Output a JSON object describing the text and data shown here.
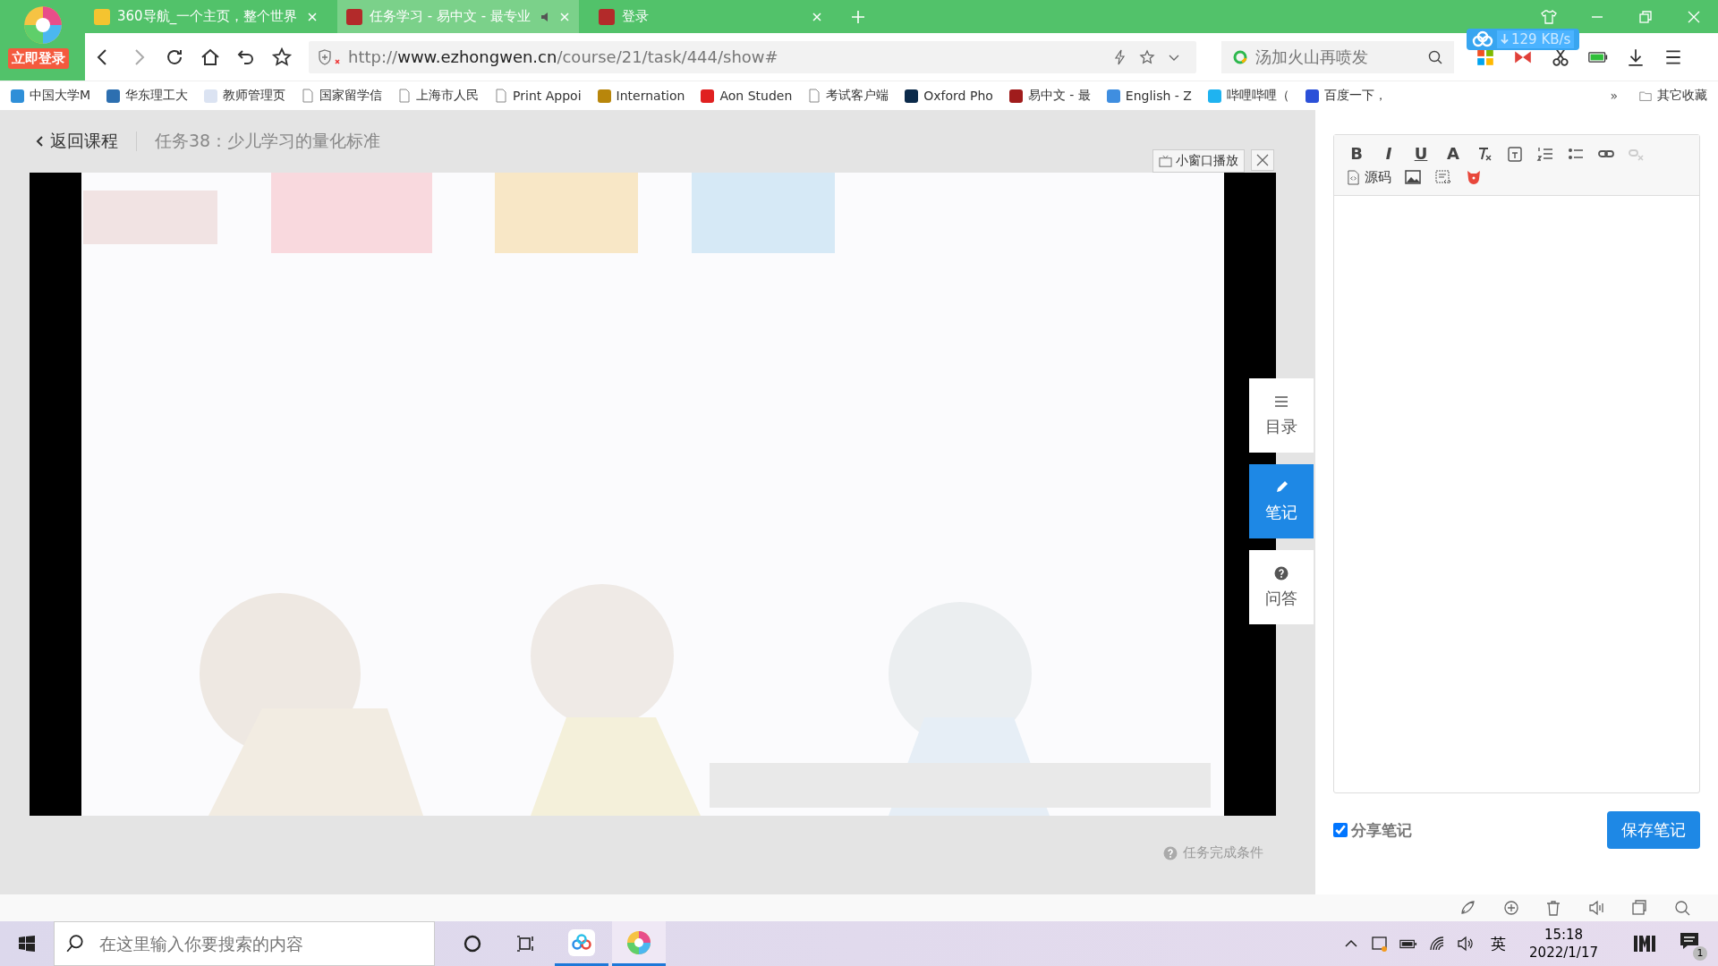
{
  "browser": {
    "login_badge": "立即登录",
    "tabs": [
      {
        "title": "360导航_一个主页，整个世界",
        "selected": false,
        "audio": false
      },
      {
        "title": "任务学习 - 易中文 - 最专业",
        "selected": true,
        "audio": true
      },
      {
        "title": "登录",
        "selected": false,
        "audio": false
      }
    ],
    "address": {
      "host": "www.ezhongwen.cn",
      "scheme": "http://",
      "path": "/course/21/task/444/show#"
    },
    "search": {
      "placeholder": "汤加火山再喷发"
    },
    "download_speed": "129 KB/s",
    "bookmarks": [
      {
        "label": "中国大学M",
        "kind": "site"
      },
      {
        "label": "华东理工大",
        "kind": "site"
      },
      {
        "label": "教师管理页",
        "kind": "site"
      },
      {
        "label": "国家留学信",
        "kind": "page"
      },
      {
        "label": "上海市人民",
        "kind": "page"
      },
      {
        "label": "Print Appoi",
        "kind": "page"
      },
      {
        "label": "Internation",
        "kind": "site"
      },
      {
        "label": "Aon Studen",
        "kind": "site"
      },
      {
        "label": "考试客户端",
        "kind": "page"
      },
      {
        "label": "Oxford Pho",
        "kind": "site"
      },
      {
        "label": "易中文 - 最",
        "kind": "site"
      },
      {
        "label": "English - Z",
        "kind": "site"
      },
      {
        "label": "哔哩哔哩（",
        "kind": "site"
      },
      {
        "label": "百度一下，",
        "kind": "site"
      }
    ],
    "more": "»",
    "other_bookmarks": "其它收藏"
  },
  "page": {
    "back_link": "返回课程",
    "task_title": "任务38：少儿学习的量化标准",
    "mini_player": "小窗口播放",
    "side_tabs": [
      {
        "label": "目录",
        "kind": "list",
        "selected": false
      },
      {
        "label": "笔记",
        "kind": "pencil",
        "selected": true
      },
      {
        "label": "问答",
        "kind": "question",
        "selected": false
      }
    ],
    "task_conditions": "任务完成条件"
  },
  "editor": {
    "format_buttons": [
      "B",
      "I",
      "U",
      "A"
    ],
    "source_label": "源码",
    "share_note": {
      "label": "分享笔记",
      "checked": true
    },
    "save_button": "保存笔记"
  },
  "taskbar": {
    "search_placeholder": "在这里输入你要搜索的内容",
    "ime": "英",
    "time": "15:18",
    "date": "2022/1/17",
    "notifications": "1"
  }
}
